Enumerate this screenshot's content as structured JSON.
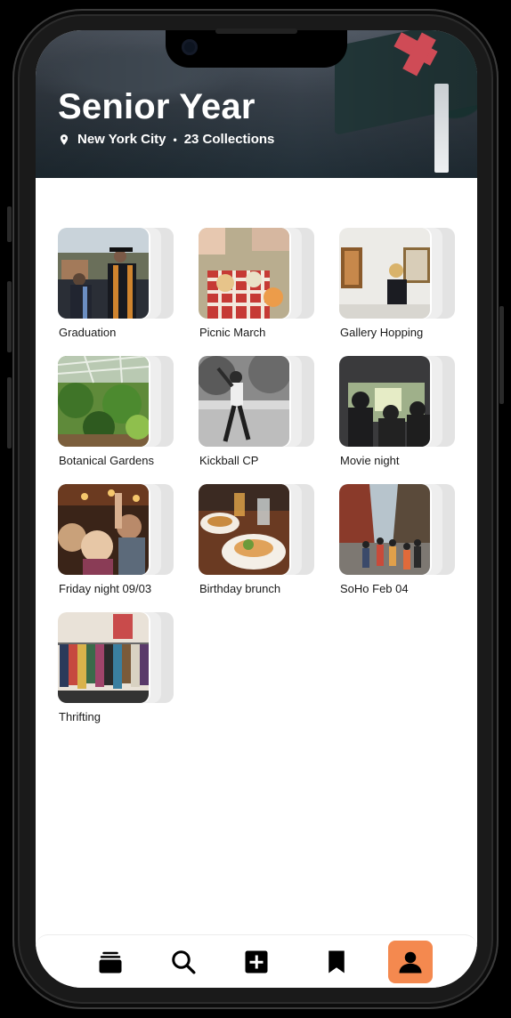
{
  "header": {
    "title": "Senior Year",
    "location": "New York City",
    "collections": "23 Collections"
  },
  "collections": [
    {
      "label": "Graduation",
      "image": "graduation-photo"
    },
    {
      "label": "Picnic March",
      "image": "picnic-photo"
    },
    {
      "label": "Gallery Hopping",
      "image": "gallery-photo"
    },
    {
      "label": "Botanical Gardens",
      "image": "greenhouse-photo"
    },
    {
      "label": "Kickball CP",
      "image": "kickball-photo"
    },
    {
      "label": "Movie night",
      "image": "movie-photo"
    },
    {
      "label": "Friday night 09/03",
      "image": "party-photo"
    },
    {
      "label": "Birthday brunch",
      "image": "brunch-photo"
    },
    {
      "label": "SoHo Feb 04",
      "image": "street-photo"
    },
    {
      "label": "Thrifting",
      "image": "clothes-rack-photo"
    }
  ],
  "nav": {
    "items": [
      {
        "icon": "collections-icon"
      },
      {
        "icon": "search-icon"
      },
      {
        "icon": "add-icon"
      },
      {
        "icon": "bookmark-icon"
      },
      {
        "icon": "profile-icon",
        "active": true
      }
    ],
    "active_color": "#f4894f"
  }
}
